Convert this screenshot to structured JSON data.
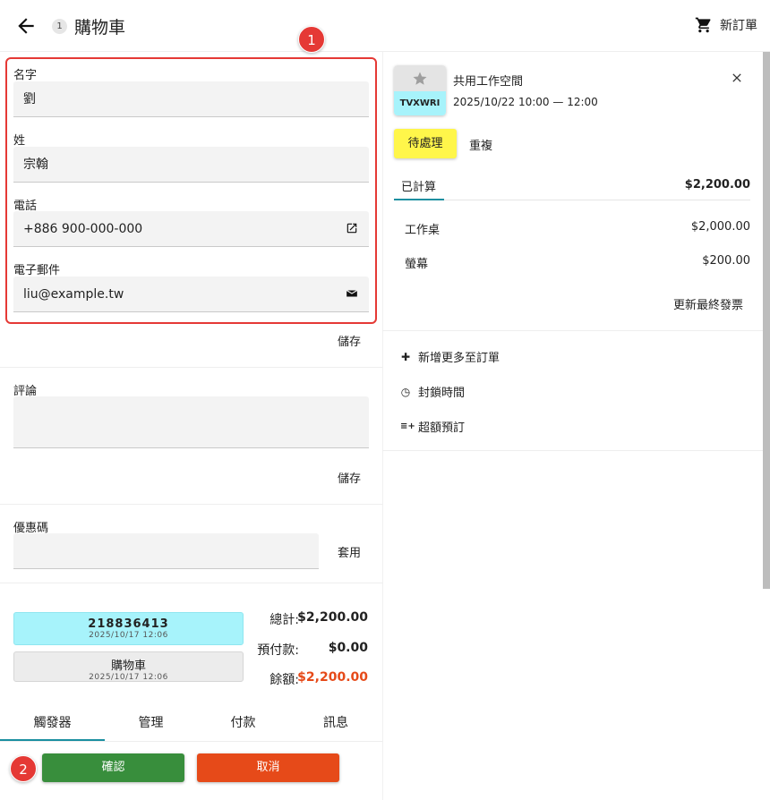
{
  "header": {
    "title": "購物車",
    "step": "1",
    "new_order_label": "新訂單"
  },
  "annotations": {
    "badge1": "1",
    "badge2": "2"
  },
  "form": {
    "first_name_label": "名字",
    "first_name_value": "劉",
    "last_name_label": "姓",
    "last_name_value": "宗翰",
    "phone_label": "電話",
    "phone_value": "+886 900-000-000",
    "email_label": "電子郵件",
    "email_value": "liu@example.tw",
    "save_label": "儲存"
  },
  "comment": {
    "label": "評論",
    "value": "",
    "save_label": "儲存"
  },
  "coupon": {
    "label": "優惠碼",
    "value": "",
    "apply_label": "套用"
  },
  "order_cards": [
    {
      "main": "218836413",
      "sub": "2025/10/17 12:06"
    },
    {
      "main": "購物車",
      "sub": "2025/10/17 12:06"
    }
  ],
  "totals": {
    "total_label": "總計:",
    "total_value": "$2,200.00",
    "deposit_label": "預付款:",
    "deposit_value": "$0.00",
    "balance_label": "餘額:",
    "balance_value": "$2,200.00"
  },
  "tabs": [
    {
      "label": "觸發器",
      "active": true
    },
    {
      "label": "管理"
    },
    {
      "label": "付款"
    },
    {
      "label": "訊息"
    }
  ],
  "actions": {
    "confirm_label": "確認",
    "cancel_label": "取消"
  },
  "item": {
    "code": "TVXWRI",
    "title": "共用工作空間",
    "time": "2025/10/22 10:00 — 12:00",
    "status_label": "待處理",
    "repeat_label": "重複",
    "calc_label": "已計算",
    "calc_total": "$2,200.00",
    "lines": [
      {
        "name": "工作桌",
        "price": "$2,000.00"
      },
      {
        "name": "螢幕",
        "price": "$200.00"
      }
    ],
    "update_invoice_label": "更新最終發票"
  },
  "right_actions": [
    {
      "icon": "plus-icon",
      "glyph": "✚",
      "label": "新增更多至訂單"
    },
    {
      "icon": "clock-icon",
      "glyph": "◷",
      "label": "封鎖時間"
    },
    {
      "icon": "overbook-icon",
      "glyph": "≡+",
      "label": "超額預訂"
    }
  ],
  "colors": {
    "accent_teal": "#1a8fa0",
    "confirm_green": "#388e3c",
    "cancel_orange": "#e64a19",
    "highlight_red": "#e53935",
    "pending_yellow": "#fff64a",
    "card_cyan": "#a7f3fb"
  }
}
